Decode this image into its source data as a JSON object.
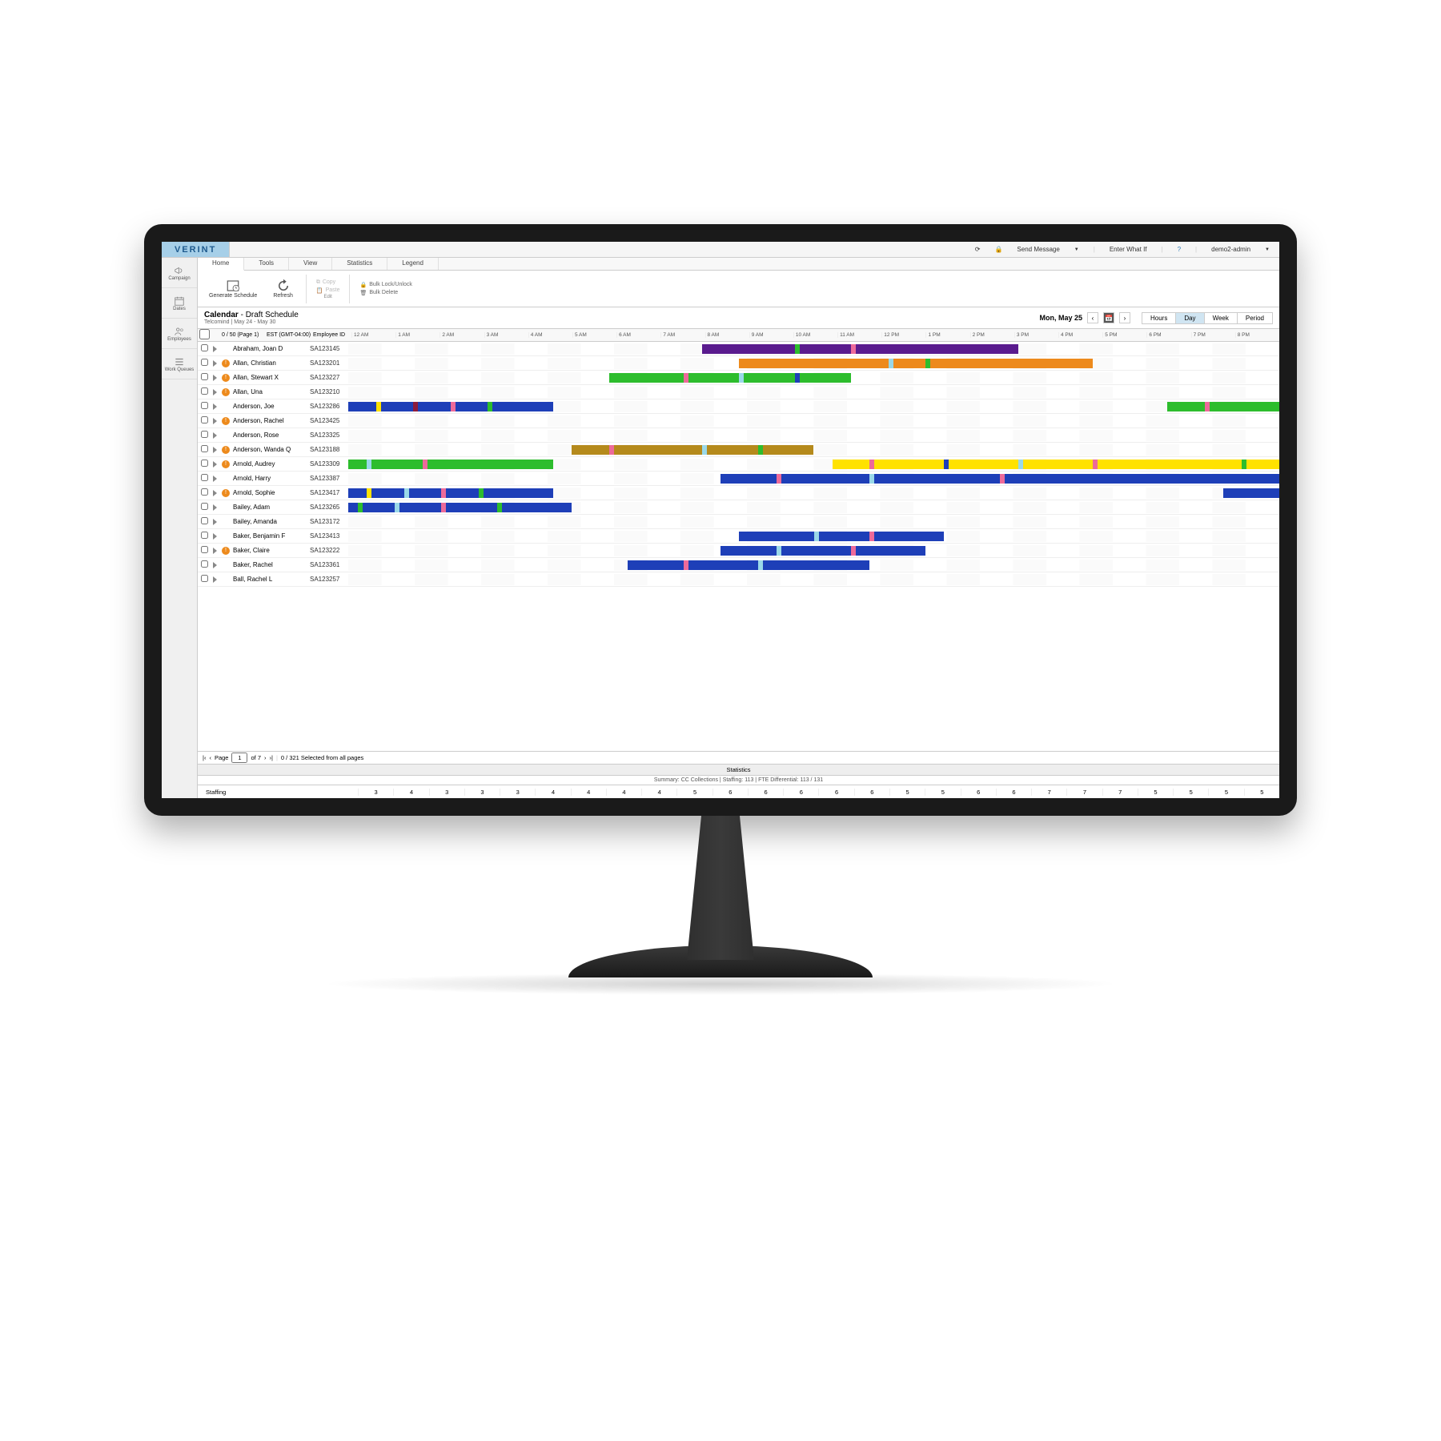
{
  "brand": "VERINT",
  "topbar": {
    "send_message": "Send Message",
    "enter_whatif": "Enter What If",
    "user": "demo2-admin"
  },
  "leftnav": [
    {
      "label": "Campaign",
      "icon": "megaphone"
    },
    {
      "label": "Dates",
      "icon": "calendar"
    },
    {
      "label": "Employees",
      "icon": "people"
    },
    {
      "label": "Work Queues",
      "icon": "queue"
    }
  ],
  "tabs": [
    "Home",
    "Tools",
    "View",
    "Statistics",
    "Legend"
  ],
  "active_tab": "Home",
  "ribbon": {
    "generate": "Generate Schedule",
    "refresh": "Refresh",
    "copy": "Copy",
    "paste": "Paste",
    "bulk_lock": "Bulk Lock/Unlock",
    "bulk_delete": "Bulk Delete",
    "edit_label": "Edit"
  },
  "calendar": {
    "title": "Calendar",
    "subtitle": "Draft Schedule",
    "org_range": "Telcomind | May 24 - May 30",
    "date": "Mon, May 25",
    "views": [
      "Hours",
      "Day",
      "Week",
      "Period"
    ],
    "active_view": "Day"
  },
  "grid_header": {
    "page": "0 / 50 (Page 1)",
    "tz": "EST (GMT-04:00)",
    "empid": "Employee ID",
    "hours": [
      "12 AM",
      "1 AM",
      "2 AM",
      "3 AM",
      "4 AM",
      "5 AM",
      "6 AM",
      "7 AM",
      "8 AM",
      "9 AM",
      "10 AM",
      "11 AM",
      "12 PM",
      "1 PM",
      "2 PM",
      "3 PM",
      "4 PM",
      "5 PM",
      "6 PM",
      "7 PM",
      "8 PM"
    ]
  },
  "employees": [
    {
      "name": "Abraham, Joan D",
      "id": "SA123145",
      "warn": false,
      "bars": [
        {
          "s": 38,
          "e": 72,
          "c": "#5a1b8e"
        }
      ],
      "segs": [
        {
          "p": 54,
          "c": "#ed6a9a"
        },
        {
          "p": 48,
          "c": "#2dbd2d"
        }
      ]
    },
    {
      "name": "Allan, Christian",
      "id": "SA123201",
      "warn": true,
      "bars": [
        {
          "s": 42,
          "e": 80,
          "c": "#ed8a1c"
        }
      ],
      "segs": [
        {
          "p": 58,
          "c": "#9ad8e8"
        },
        {
          "p": 62,
          "c": "#2dbd2d"
        }
      ]
    },
    {
      "name": "Allan, Stewart X",
      "id": "SA123227",
      "warn": true,
      "bars": [
        {
          "s": 28,
          "e": 54,
          "c": "#2dbd2d"
        }
      ],
      "segs": [
        {
          "p": 36,
          "c": "#ed6a9a"
        },
        {
          "p": 42,
          "c": "#9ad8e8"
        },
        {
          "p": 48,
          "c": "#1e3fb8"
        }
      ]
    },
    {
      "name": "Allan, Una",
      "id": "SA123210",
      "warn": true,
      "bars": [],
      "segs": []
    },
    {
      "name": "Anderson, Joe",
      "id": "SA123286",
      "warn": false,
      "bars": [
        {
          "s": 0,
          "e": 22,
          "c": "#1e3fb8"
        },
        {
          "s": 88,
          "e": 100,
          "c": "#2dbd2d"
        }
      ],
      "segs": [
        {
          "p": 3,
          "c": "#ffe200"
        },
        {
          "p": 7,
          "c": "#8e1b3c"
        },
        {
          "p": 11,
          "c": "#ed6a9a"
        },
        {
          "p": 15,
          "c": "#2dbd2d"
        },
        {
          "p": 92,
          "c": "#ed6a9a"
        }
      ]
    },
    {
      "name": "Anderson, Rachel",
      "id": "SA123425",
      "warn": true,
      "bars": [],
      "segs": []
    },
    {
      "name": "Anderson, Rose",
      "id": "SA123325",
      "warn": false,
      "bars": [],
      "segs": []
    },
    {
      "name": "Anderson, Wanda Q",
      "id": "SA123188",
      "warn": true,
      "bars": [
        {
          "s": 24,
          "e": 50,
          "c": "#b58a1c"
        }
      ],
      "segs": [
        {
          "p": 28,
          "c": "#ed6a9a"
        },
        {
          "p": 38,
          "c": "#9ad8e8"
        },
        {
          "p": 44,
          "c": "#2dbd2d"
        }
      ]
    },
    {
      "name": "Arnold, Audrey",
      "id": "SA123309",
      "warn": true,
      "bars": [
        {
          "s": 0,
          "e": 22,
          "c": "#2dbd2d"
        },
        {
          "s": 52,
          "e": 100,
          "c": "#ffe200"
        }
      ],
      "segs": [
        {
          "p": 2,
          "c": "#9ad8e8"
        },
        {
          "p": 8,
          "c": "#ed6a9a"
        },
        {
          "p": 56,
          "c": "#ed6a9a"
        },
        {
          "p": 64,
          "c": "#1e3fb8"
        },
        {
          "p": 72,
          "c": "#9ad8e8"
        },
        {
          "p": 80,
          "c": "#ed6a9a"
        },
        {
          "p": 96,
          "c": "#2dbd2d"
        }
      ]
    },
    {
      "name": "Arnold, Harry",
      "id": "SA123387",
      "warn": false,
      "bars": [
        {
          "s": 40,
          "e": 100,
          "c": "#1e3fb8"
        }
      ],
      "segs": [
        {
          "p": 46,
          "c": "#ed6a9a"
        },
        {
          "p": 56,
          "c": "#9ad8e8"
        },
        {
          "p": 70,
          "c": "#ed6a9a"
        }
      ]
    },
    {
      "name": "Arnold, Sophie",
      "id": "SA123417",
      "warn": true,
      "bars": [
        {
          "s": 0,
          "e": 22,
          "c": "#1e3fb8"
        },
        {
          "s": 94,
          "e": 100,
          "c": "#1e3fb8"
        }
      ],
      "segs": [
        {
          "p": 2,
          "c": "#ffe200"
        },
        {
          "p": 6,
          "c": "#9ad8e8"
        },
        {
          "p": 10,
          "c": "#ed6a9a"
        },
        {
          "p": 14,
          "c": "#2dbd2d"
        }
      ]
    },
    {
      "name": "Bailey, Adam",
      "id": "SA123265",
      "warn": false,
      "bars": [
        {
          "s": 0,
          "e": 24,
          "c": "#1e3fb8"
        }
      ],
      "segs": [
        {
          "p": 1,
          "c": "#2dbd2d"
        },
        {
          "p": 5,
          "c": "#9ad8e8"
        },
        {
          "p": 10,
          "c": "#ed6a9a"
        },
        {
          "p": 16,
          "c": "#2dbd2d"
        }
      ]
    },
    {
      "name": "Bailey, Amanda",
      "id": "SA123172",
      "warn": false,
      "bars": [],
      "segs": []
    },
    {
      "name": "Baker, Benjamin F",
      "id": "SA123413",
      "warn": false,
      "bars": [
        {
          "s": 42,
          "e": 64,
          "c": "#1e3fb8"
        }
      ],
      "segs": [
        {
          "p": 50,
          "c": "#9ad8e8"
        },
        {
          "p": 56,
          "c": "#ed6a9a"
        }
      ]
    },
    {
      "name": "Baker, Claire",
      "id": "SA123222",
      "warn": true,
      "bars": [
        {
          "s": 40,
          "e": 62,
          "c": "#1e3fb8"
        }
      ],
      "segs": [
        {
          "p": 46,
          "c": "#9ad8e8"
        },
        {
          "p": 54,
          "c": "#ed6a9a"
        }
      ]
    },
    {
      "name": "Baker, Rachel",
      "id": "SA123361",
      "warn": false,
      "bars": [
        {
          "s": 30,
          "e": 56,
          "c": "#1e3fb8"
        }
      ],
      "segs": [
        {
          "p": 36,
          "c": "#ed6a9a"
        },
        {
          "p": 44,
          "c": "#9ad8e8"
        }
      ]
    },
    {
      "name": "Ball, Rachel L",
      "id": "SA123257",
      "warn": false,
      "bars": [],
      "segs": []
    }
  ],
  "pager": {
    "page_label": "Page",
    "page": "1",
    "of": "of 7",
    "selected": "0 / 321 Selected from all pages"
  },
  "stats_label": "Statistics",
  "summary_text": "Summary: CC Collections  |  Staffing: 113  |  FTE Differential: 113 / 131",
  "staffing": {
    "label": "Staffing",
    "vals": [
      "3",
      "4",
      "3",
      "3",
      "3",
      "4",
      "4",
      "4",
      "4",
      "5",
      "6",
      "6",
      "6",
      "6",
      "6",
      "5",
      "5",
      "6",
      "6",
      "7",
      "7",
      "7",
      "5",
      "5",
      "5",
      "5"
    ]
  }
}
